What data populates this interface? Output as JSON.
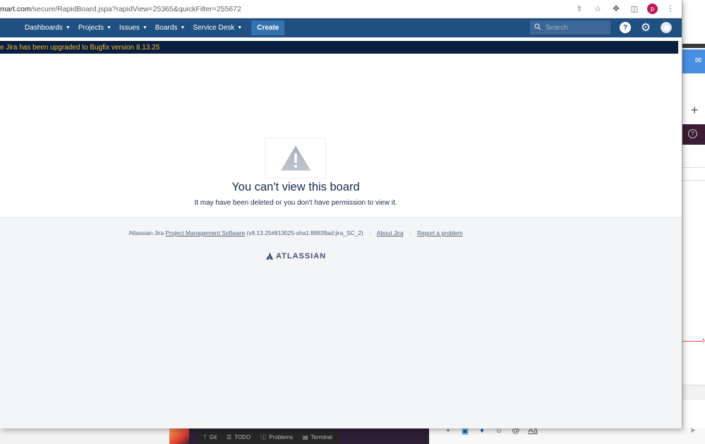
{
  "browser": {
    "url_host": "mart.com",
    "url_path": "/secure/RapidBoard.jspa?rapidView=25365&quickFilter=255672",
    "profile_initial": "p"
  },
  "header": {
    "nav": [
      {
        "label": "Dashboards"
      },
      {
        "label": "Projects"
      },
      {
        "label": "Issues"
      },
      {
        "label": "Boards"
      },
      {
        "label": "Service Desk"
      }
    ],
    "create_label": "Create",
    "search_placeholder": "Search"
  },
  "banner": {
    "text": "e Jira has been upgraded to Bugfix version 8.13.25"
  },
  "error": {
    "title": "You can't view this board",
    "message": "It may have been deleted or you don't have permission to view it."
  },
  "footer": {
    "prefix": "Atlassian Jira",
    "pm_link": "Project Management Software",
    "version": "(v8.13.25#813025-sha1:88839ad:jira_SC_2)",
    "about_link": "About Jira",
    "report_link": "Report a problem",
    "logo_text": "ATLASSIAN",
    "separator": "·"
  },
  "ide": {
    "tools": [
      {
        "label": "Git",
        "icon": "git-branch-icon"
      },
      {
        "label": "TODO",
        "icon": "list-icon"
      },
      {
        "label": "Problems",
        "icon": "info-icon"
      },
      {
        "label": "Terminal",
        "icon": "terminal-icon"
      }
    ]
  },
  "right_panel": {
    "red_marker": "N"
  },
  "colors": {
    "jira_header": "#205081",
    "banner_bg": "#0a1f3d",
    "banner_text": "#f0b93b",
    "create_button": "#3572b0"
  }
}
